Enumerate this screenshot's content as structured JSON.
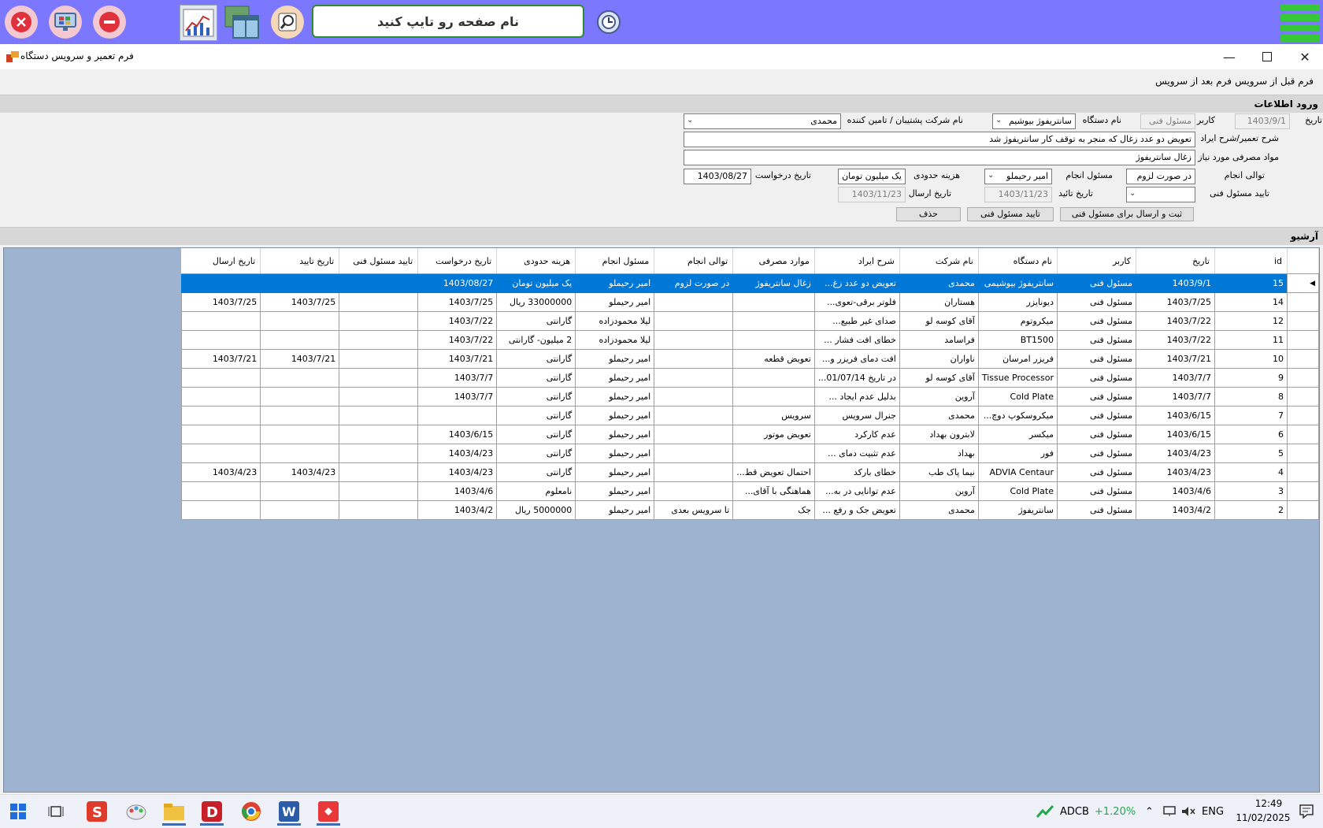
{
  "topbar": {
    "search_placeholder": "نام صفحه رو تایپ کنید",
    "icons": [
      "close-circle-icon",
      "monitor-icon",
      "minus-circle-icon",
      "chart-icon",
      "windows-icon",
      "magnify-icon",
      "history-icon",
      "menu-icon"
    ]
  },
  "window": {
    "title": "فرم تعمیر و سرویس دستگاه",
    "menu": {
      "before": "فرم قبل از سرویس",
      "after": "فرم بعد از سرویس"
    }
  },
  "entry": {
    "section_title": "ورود اطلاعات",
    "date_label": "تاریخ",
    "date_value": "1403/9/1",
    "user_label": "کاربر",
    "user_value": "مسئول فنی",
    "device_label": "نام دستگاه",
    "device_value": "سانتریفوژ بیوشیم",
    "company_label": "نام شرکت پشتیبان / تامین کننده",
    "company_value": "محمدی",
    "desc_label": "شرح تعمیر/شرح ایراد",
    "desc_value": "تعویض دو عدد زغال که منجر به توقف کار سانتریفوژ شد",
    "materials_label": "مواد مصرفی مورد نیاز",
    "materials_value": "زغال سانتریفوژ",
    "priority_label": "توالی انجام",
    "priority_value": "در صورت لزوم",
    "responsible_label": "مسئول انجام",
    "responsible_value": "امیر رحیملو",
    "cost_label": "هزینه حدودی",
    "cost_value": "یک میلیون تومان",
    "request_date_label": "تاریخ درخواست",
    "request_date_value": "1403/08/27",
    "approve_label": "تایید مسئول فنی",
    "approve_value": "",
    "approve_date_label": "تاریخ تائید",
    "approve_date_value": "1403/11/23",
    "send_date_label": "تاریخ ارسال",
    "send_date_value": "1403/11/23",
    "btn_submit": "ثبت و ارسال برای مسئول فنی",
    "btn_approve": "تایید مسئول فنی",
    "btn_delete": "حذف"
  },
  "archive": {
    "section_title": "آرشیو",
    "columns": [
      "id",
      "تاریخ",
      "کاربر",
      "نام دستگاه",
      "نام شرکت",
      "شرح ایراد",
      "موارد مصرفی",
      "توالی انجام",
      "مسئول انجام",
      "هزینه حدودی",
      "تاریخ درخواست",
      "تایید مسئول فنی",
      "تاریخ تایید",
      "تاریخ ارسال"
    ],
    "rows": [
      [
        "15",
        "1403/9/1",
        "مسئول فنی",
        "سانتریفوژ بیوشیمی",
        "محمدی",
        "تعویض دو عدد زغ...",
        "زغال سانتریفوژ",
        "در صورت لزوم",
        "امیر رحیملو",
        "یک میلیون تومان",
        "1403/08/27",
        "",
        "",
        ""
      ],
      [
        "14",
        "1403/7/25",
        "مسئول فنی",
        "دیونایزر",
        "هستاران",
        "فلوتر برقی-تعوی...",
        "",
        "",
        "امیر رحیملو",
        "33000000 ریال",
        "1403/7/25",
        "",
        "1403/7/25",
        "1403/7/25"
      ],
      [
        "12",
        "1403/7/22",
        "مسئول فنی",
        "میکروتوم",
        "آقای کوسه لو",
        "صدای غیر طبیع...",
        "",
        "",
        "لیلا محمودزاده",
        "گارانتی",
        "1403/7/22",
        "",
        "",
        ""
      ],
      [
        "11",
        "1403/7/22",
        "مسئول فنی",
        "BT1500",
        "فراسامد",
        "خطای افت فشار ...",
        "",
        "",
        "لیلا محمودزاده",
        "2 میلیون- گارانتی",
        "1403/7/22",
        "",
        "",
        ""
      ],
      [
        "10",
        "1403/7/21",
        "مسئول فنی",
        "فریزر امرسان",
        "ناواران",
        "افت دمای فریزر و...",
        "تعویض قطعه",
        "",
        "امیر رحیملو",
        "گارانتی",
        "1403/7/21",
        "",
        "1403/7/21",
        "1403/7/21"
      ],
      [
        "9",
        "1403/7/7",
        "مسئول فنی",
        "Tissue Processor",
        "آقای کوسه لو",
        "در تاریخ 01/07/14...",
        "",
        "",
        "امیر رحیملو",
        "گارانتی",
        "1403/7/7",
        "",
        "",
        ""
      ],
      [
        "8",
        "1403/7/7",
        "مسئول فنی",
        "Cold Plate",
        "آروین",
        "بدلیل عدم ایجاد ...",
        "",
        "",
        "امیر رحیملو",
        "گارانتی",
        "1403/7/7",
        "",
        "",
        ""
      ],
      [
        "7",
        "1403/6/15",
        "مسئول فنی",
        "میکروسکوپ دوچ...",
        "محمدی",
        "جنرال سرویس",
        "سرویس",
        "",
        "امیر رحیملو",
        "گارانتی",
        "",
        "",
        "",
        ""
      ],
      [
        "6",
        "1403/6/15",
        "مسئول فنی",
        "میکسر",
        "لابترون بهداد",
        "عدم کارکرد",
        "تعویض موتور",
        "",
        "امیر رحیملو",
        "گارانتی",
        "1403/6/15",
        "",
        "",
        ""
      ],
      [
        "5",
        "1403/4/23",
        "مسئول فنی",
        "فور",
        "بهداد",
        "عدم تثبیت دمای ...",
        "",
        "",
        "امیر رحیملو",
        "گارانتی",
        "1403/4/23",
        "",
        "",
        ""
      ],
      [
        "4",
        "1403/4/23",
        "مسئول فنی",
        "ADVIA Centaur",
        "نیما پاک طب",
        "خطای بارکد",
        "احتمال تعویض قط...",
        "",
        "امیر رحیملو",
        "گارانتی",
        "1403/4/23",
        "",
        "1403/4/23",
        "1403/4/23"
      ],
      [
        "3",
        "1403/4/6",
        "مسئول فنی",
        "Cold Plate",
        "آروین",
        "عدم توانایی در به...",
        "هماهنگی با آقای...",
        "",
        "امیر رحیملو",
        "نامعلوم",
        "1403/4/6",
        "",
        "",
        ""
      ],
      [
        "2",
        "1403/4/2",
        "مسئول فنی",
        "سانتریفوژ",
        "محمدی",
        "تعویض جک و رفع ...",
        "جک",
        "تا سرویس بعدی",
        "امیر رحیملو",
        "5000000 ریال",
        "1403/4/2",
        "",
        "",
        ""
      ]
    ]
  },
  "taskbar": {
    "stock_name": "ADCB",
    "stock_change": "+1.20%",
    "lang": "ENG",
    "time": "12:49",
    "date": "11/02/2025"
  }
}
